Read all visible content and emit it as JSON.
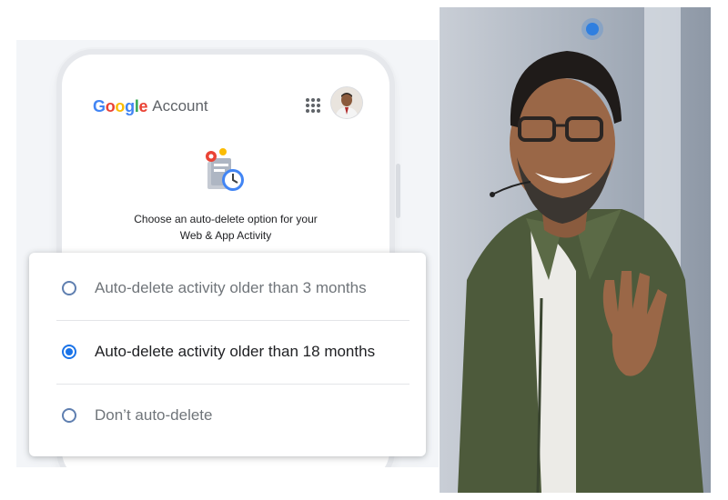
{
  "account_header": {
    "brand_letters": [
      {
        "ch": "G",
        "color": "#4285F4"
      },
      {
        "ch": "o",
        "color": "#EA4335"
      },
      {
        "ch": "o",
        "color": "#FBBC05"
      },
      {
        "ch": "g",
        "color": "#4285F4"
      },
      {
        "ch": "l",
        "color": "#34A853"
      },
      {
        "ch": "e",
        "color": "#EA4335"
      }
    ],
    "account_word": "Account",
    "apps_icon": "apps-grid-icon",
    "avatar_icon": "avatar"
  },
  "illustration_icon": "activity-clock-icon",
  "prompt": {
    "line1": "Choose an auto-delete option for your",
    "line2": "Web & App Activity"
  },
  "options": [
    {
      "label": "Auto-delete activity older than 3 months",
      "selected": false
    },
    {
      "label": "Auto-delete activity older than 18 months",
      "selected": true
    },
    {
      "label": "Don’t auto-delete",
      "selected": false
    }
  ],
  "colors": {
    "accent": "#1a73e8",
    "text_primary": "#202124",
    "text_secondary": "#70757a"
  }
}
